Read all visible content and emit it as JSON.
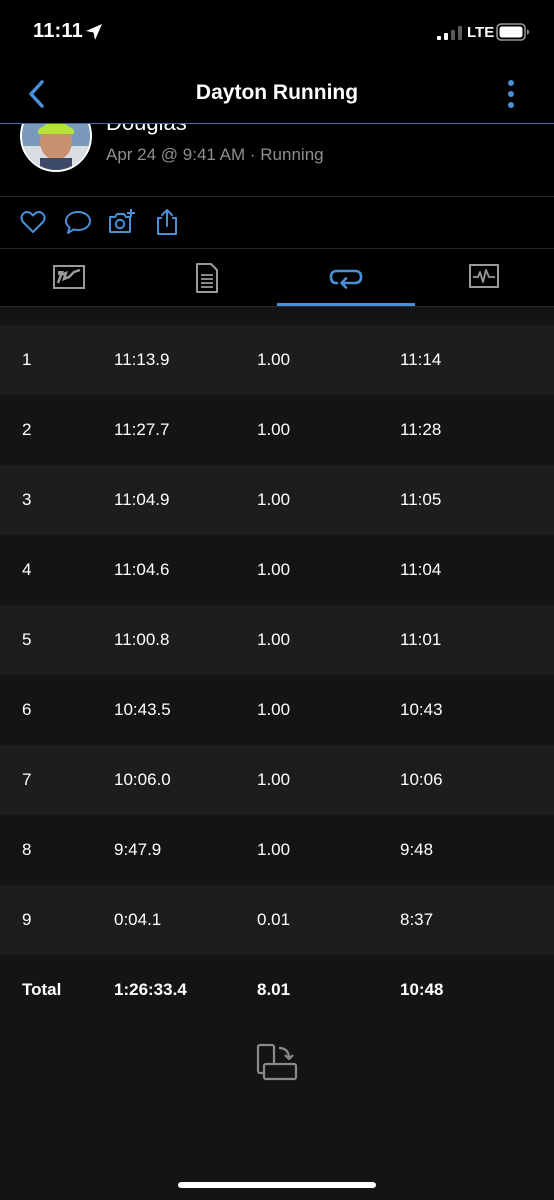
{
  "status_bar": {
    "time": "11:11",
    "network": "LTE"
  },
  "nav": {
    "title": "Dayton Running"
  },
  "activity": {
    "user_name": "Douglas",
    "meta": "Apr 24 @ 9:41 AM · Running"
  },
  "actions": [
    "heart-icon",
    "comment-icon",
    "add-photo-icon",
    "share-icon"
  ],
  "tabs": [
    {
      "name": "map-tab",
      "icon": "map-icon",
      "selected": false
    },
    {
      "name": "details-tab",
      "icon": "document-icon",
      "selected": false
    },
    {
      "name": "laps-tab",
      "icon": "loop-icon",
      "selected": true
    },
    {
      "name": "charts-tab",
      "icon": "chart-icon",
      "selected": false
    }
  ],
  "laps": [
    {
      "lap": "1",
      "time": "11:13.9",
      "distance": "1.00",
      "pace": "11:14"
    },
    {
      "lap": "2",
      "time": "11:27.7",
      "distance": "1.00",
      "pace": "11:28"
    },
    {
      "lap": "3",
      "time": "11:04.9",
      "distance": "1.00",
      "pace": "11:05"
    },
    {
      "lap": "4",
      "time": "11:04.6",
      "distance": "1.00",
      "pace": "11:04"
    },
    {
      "lap": "5",
      "time": "11:00.8",
      "distance": "1.00",
      "pace": "11:01"
    },
    {
      "lap": "6",
      "time": "10:43.5",
      "distance": "1.00",
      "pace": "10:43"
    },
    {
      "lap": "7",
      "time": "10:06.0",
      "distance": "1.00",
      "pace": "10:06"
    },
    {
      "lap": "8",
      "time": "9:47.9",
      "distance": "1.00",
      "pace": "9:48"
    },
    {
      "lap": "9",
      "time": "0:04.1",
      "distance": "0.01",
      "pace": "8:37"
    }
  ],
  "total": {
    "label": "Total",
    "time": "1:26:33.4",
    "distance": "8.01",
    "pace": "10:48"
  },
  "colors": {
    "accent": "#4a90d9",
    "background": "#141414",
    "row_alt": "#1d1d1d",
    "bar": "#000000",
    "muted": "#8e8e93"
  }
}
